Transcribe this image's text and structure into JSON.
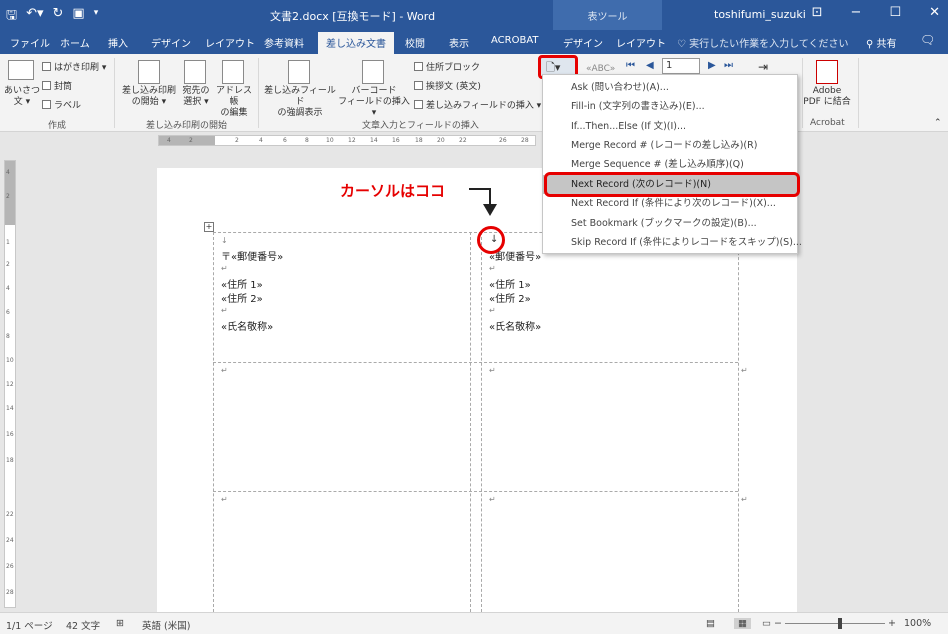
{
  "title_bar": {
    "doc_title": "文書2.docx [互換モード] - Word",
    "context_tool": "表ツール",
    "user": "toshifumi_suzuki",
    "qat_icons": [
      "save-icon",
      "undo-icon",
      "redo-icon",
      "preview-icon",
      "customize-icon"
    ]
  },
  "tabs": [
    "ファイル",
    "ホーム",
    "挿入",
    "デザイン",
    "レイアウト",
    "参考資料",
    "差し込み文書",
    "校閲",
    "表示",
    "ACROBAT",
    "デザイン",
    "レイアウト"
  ],
  "active_tab": "差し込み文書",
  "tell_me": "実行したい作業を入力してください",
  "share": "共有",
  "ribbon": {
    "create": {
      "label": "作成",
      "greeting_l1": "あいさつ",
      "greeting_l2": "文 ▾",
      "hagaki": "はがき印刷 ▾",
      "envelope": "封筒",
      "label_btn": "ラベル"
    },
    "start_merge": {
      "label": "差し込み印刷の開始",
      "start_l1": "差し込み印刷",
      "start_l2": "の開始 ▾",
      "select_l1": "宛先の",
      "select_l2": "選択 ▾",
      "edit_l1": "アドレス帳",
      "edit_l2": "の編集"
    },
    "write_insert": {
      "label": "文章入力とフィールドの挿入",
      "highlight_l1": "差し込みフィールド",
      "highlight_l2": "の強調表示",
      "barcode_l1": "バーコード",
      "barcode_l2": "フィールドの挿入 ▾",
      "address_block": "住所ブロック",
      "greeting_line": "挨拶文 (英文)",
      "insert_field": "差し込みフィールドの挿入 ▾"
    },
    "preview": {
      "record_value": "1"
    },
    "acrobat": {
      "label": "Acrobat",
      "btn_l1": "Adobe",
      "btn_l2": "PDF に結合"
    }
  },
  "rules_menu": {
    "items": [
      "Ask (問い合わせ)(A)...",
      "Fill-in (文字列の書き込み)(E)...",
      "If...Then...Else (If 文)(I)...",
      "Merge Record # (レコードの差し込み)(R)",
      "Merge Sequence # (差し込み順序)(Q)",
      "Next Record (次のレコード)(N)",
      "Next Record If (条件により次のレコード)(X)...",
      "Set Bookmark (ブックマークの設定)(B)...",
      "Skip Record If (条件によりレコードをスキップ)(S)..."
    ],
    "selected_index": 5
  },
  "annotation": "カーソルはココ",
  "ruler_h": [
    "4",
    "2",
    "2",
    "4",
    "6",
    "8",
    "10",
    "12",
    "14",
    "16",
    "18",
    "20",
    "22",
    "26",
    "28"
  ],
  "ruler_v": [
    "4",
    "2",
    "1",
    "2",
    "4",
    "6",
    "8",
    "10",
    "12",
    "14",
    "16",
    "18",
    "22",
    "24",
    "26",
    "28"
  ],
  "document": {
    "cell1": [
      "〒«郵便番号»",
      "«住所 1»",
      "«住所 2»",
      "«氏名敬称»"
    ],
    "cell2": [
      "«郵便番号»",
      "«住所 1»",
      "«住所 2»",
      "«氏名敬称»"
    ],
    "cursor_glyph": "↓",
    "para_glyph": "↵"
  },
  "status": {
    "page": "1/1 ページ",
    "words": "42 文字",
    "lang": "英語 (米国)",
    "zoom": "100%",
    "zoom_minus": "−",
    "zoom_plus": "+"
  }
}
